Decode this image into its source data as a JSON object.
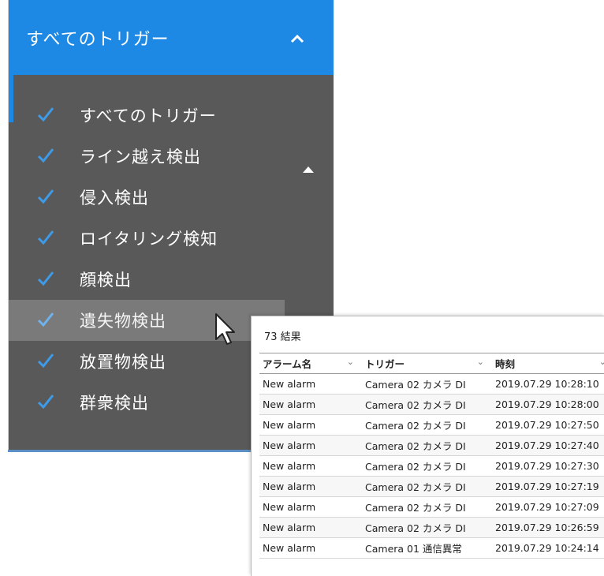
{
  "dropdown": {
    "title": "すべてのトリガー",
    "items": [
      {
        "label": "すべてのトリガー",
        "checked": true
      },
      {
        "label": "ライン越え検出",
        "checked": true
      },
      {
        "label": "侵入検出",
        "checked": true
      },
      {
        "label": "ロイタリング検知",
        "checked": true
      },
      {
        "label": "顔検出",
        "checked": true
      },
      {
        "label": "遺失物検出",
        "checked": true,
        "hovered": true
      },
      {
        "label": "放置物検出",
        "checked": true
      },
      {
        "label": "群衆検出",
        "checked": true
      }
    ],
    "colors": {
      "header": "#1e88e5",
      "panel": "#595959",
      "check": "#3d9be9"
    },
    "icons": {
      "collapse": "chevron-up-icon",
      "scroll": "triangle-up-icon",
      "check": "checkmark-icon",
      "cursor": "mouse-pointer-icon"
    }
  },
  "results": {
    "count_label": "73 結果",
    "columns": [
      "アラーム名",
      "トリガー",
      "時刻"
    ],
    "rows": [
      [
        "New alarm",
        "Camera 02 カメラ DI",
        "2019.07.29 10:28:10"
      ],
      [
        "New alarm",
        "Camera 02 カメラ DI",
        "2019.07.29 10:28:00"
      ],
      [
        "New alarm",
        "Camera 02 カメラ DI",
        "2019.07.29 10:27:50"
      ],
      [
        "New alarm",
        "Camera 02 カメラ DI",
        "2019.07.29 10:27:40"
      ],
      [
        "New alarm",
        "Camera 02 カメラ DI",
        "2019.07.29 10:27:30"
      ],
      [
        "New alarm",
        "Camera 02 カメラ DI",
        "2019.07.29 10:27:19"
      ],
      [
        "New alarm",
        "Camera 02 カメラ DI",
        "2019.07.29 10:27:09"
      ],
      [
        "New alarm",
        "Camera 02 カメラ DI",
        "2019.07.29 10:26:59"
      ],
      [
        "New alarm",
        "Camera 01 通信異常",
        "2019.07.29 10:24:14"
      ]
    ]
  }
}
